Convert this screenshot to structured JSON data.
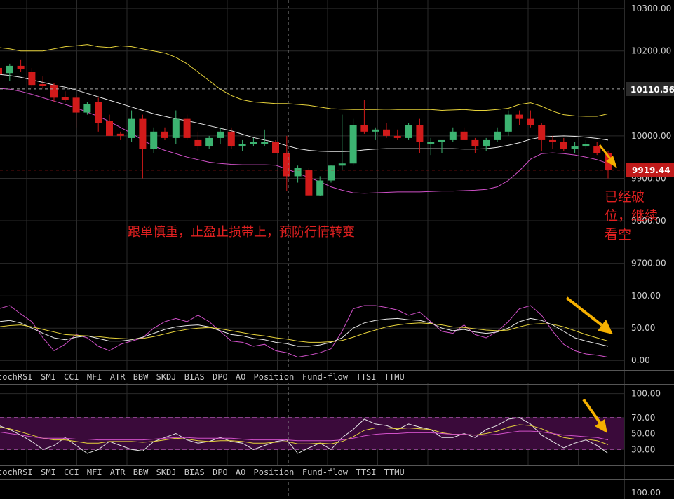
{
  "colors": {
    "background": "#000000",
    "grid": "#2a2a2a",
    "up": "#3cb371",
    "down": "#d11a1a",
    "bb_upper": "#e6d23a",
    "bb_mid": "#e8e8e8",
    "bb_lower": "#d050c8",
    "annotation": "#e02020",
    "arrow": "#f5b000",
    "oscillator_band": "#3a0a3a"
  },
  "chart_data": [
    {
      "type": "candlestick",
      "panel": "price",
      "ylim": [
        9640,
        10320
      ],
      "yticks": [
        "10300.00",
        "10200.00",
        "10000.00",
        "9900.00",
        "9800.00",
        "9700.00"
      ],
      "ytick_values": [
        10300,
        10200,
        10000,
        9900,
        9800,
        9700
      ],
      "price_tag": "10110.56",
      "price_tag_value": 10110.56,
      "last_price": "9919.44",
      "last_price_value": 9919.44,
      "candles": [
        [
          10160,
          10175,
          10140,
          10145
        ],
        [
          10148,
          10170,
          10130,
          10165
        ],
        [
          10165,
          10180,
          10150,
          10158
        ],
        [
          10150,
          10160,
          10110,
          10120
        ],
        [
          10122,
          10140,
          10110,
          10118
        ],
        [
          10120,
          10125,
          10080,
          10090
        ],
        [
          10092,
          10105,
          10080,
          10085
        ],
        [
          10090,
          10095,
          10020,
          10055
        ],
        [
          10055,
          10080,
          10050,
          10075
        ],
        [
          10080,
          10090,
          10010,
          10030
        ],
        [
          10035,
          10050,
          10000,
          10000
        ],
        [
          10005,
          10010,
          9990,
          10000
        ],
        [
          9995,
          10060,
          9985,
          10040
        ],
        [
          10040,
          10050,
          9900,
          9970
        ],
        [
          9970,
          10020,
          9960,
          10010
        ],
        [
          10010,
          10020,
          9990,
          9995
        ],
        [
          9995,
          10060,
          9980,
          10040
        ],
        [
          10040,
          10050,
          9990,
          9995
        ],
        [
          9990,
          10010,
          9965,
          9975
        ],
        [
          9975,
          10000,
          9970,
          9995
        ],
        [
          9995,
          10020,
          9980,
          10010
        ],
        [
          10010,
          10020,
          9970,
          9975
        ],
        [
          9975,
          9990,
          9965,
          9980
        ],
        [
          9980,
          9995,
          9975,
          9985
        ],
        [
          9985,
          10015,
          9975,
          9985
        ],
        [
          9985,
          9990,
          9960,
          9960
        ],
        [
          9960,
          10000,
          9870,
          9905
        ],
        [
          9905,
          9930,
          9890,
          9925
        ],
        [
          9920,
          9925,
          9860,
          9860
        ],
        [
          9860,
          9905,
          9858,
          9895
        ],
        [
          9895,
          9930,
          9890,
          9930
        ],
        [
          9930,
          10050,
          9920,
          9935
        ],
        [
          9935,
          10040,
          9930,
          10025
        ],
        [
          10025,
          10085,
          10005,
          10010
        ],
        [
          10010,
          10020,
          9990,
          10015
        ],
        [
          10015,
          10030,
          9995,
          10000
        ],
        [
          10000,
          10015,
          9990,
          9995
        ],
        [
          9995,
          10030,
          9990,
          10025
        ],
        [
          10025,
          10040,
          9960,
          9985
        ],
        [
          9985,
          9995,
          9955,
          9985
        ],
        [
          9985,
          9990,
          9960,
          9990
        ],
        [
          9990,
          10020,
          9985,
          10010
        ],
        [
          10010,
          10020,
          9990,
          9990
        ],
        [
          9990,
          9995,
          9960,
          9975
        ],
        [
          9975,
          9995,
          9965,
          9990
        ],
        [
          9990,
          10020,
          9985,
          10010
        ],
        [
          10010,
          10060,
          10000,
          10050
        ],
        [
          10050,
          10060,
          10025,
          10040
        ],
        [
          10040,
          10060,
          10020,
          10025
        ],
        [
          10025,
          10030,
          9965,
          9990
        ],
        [
          9990,
          10000,
          9970,
          9985
        ],
        [
          9985,
          9995,
          9965,
          9970
        ],
        [
          9970,
          9985,
          9960,
          9975
        ],
        [
          9975,
          9990,
          9970,
          9980
        ],
        [
          9975,
          9985,
          9955,
          9960
        ],
        [
          9960,
          9965,
          9900,
          9919
        ]
      ],
      "bb_upper": [
        10208,
        10205,
        10200,
        10200,
        10200,
        10205,
        10210,
        10212,
        10215,
        10210,
        10208,
        10212,
        10210,
        10205,
        10200,
        10195,
        10185,
        10170,
        10150,
        10130,
        10110,
        10095,
        10085,
        10080,
        10078,
        10076,
        10076,
        10074,
        10072,
        10068,
        10064,
        10063,
        10062,
        10062,
        10062,
        10063,
        10062,
        10062,
        10062,
        10062,
        10060,
        10061,
        10062,
        10060,
        10060,
        10062,
        10065,
        10074,
        10078,
        10070,
        10058,
        10050,
        10047,
        10046,
        10046,
        10052
      ],
      "bb_mid": [
        10145,
        10142,
        10138,
        10132,
        10126,
        10120,
        10115,
        10108,
        10100,
        10092,
        10084,
        10076,
        10068,
        10060,
        10052,
        10046,
        10040,
        10036,
        10030,
        10024,
        10018,
        10012,
        10004,
        9996,
        9990,
        9985,
        9977,
        9970,
        9966,
        9964,
        9963,
        9963,
        9964,
        9967,
        9969,
        9970,
        9970,
        9970,
        9970,
        9970,
        9970,
        9970,
        9969,
        9969,
        9970,
        9973,
        9978,
        9984,
        9992,
        9997,
        9999,
        10000,
        9999,
        9997,
        9994,
        9990
      ],
      "bb_lower": [
        10112,
        10110,
        10105,
        10098,
        10090,
        10082,
        10074,
        10066,
        10056,
        10046,
        10034,
        10020,
        10006,
        9990,
        9976,
        9966,
        9958,
        9950,
        9944,
        9938,
        9935,
        9933,
        9932,
        9932,
        9932,
        9931,
        9922,
        9912,
        9902,
        9892,
        9880,
        9872,
        9866,
        9865,
        9866,
        9867,
        9868,
        9868,
        9868,
        9869,
        9870,
        9870,
        9871,
        9872,
        9874,
        9880,
        9895,
        9918,
        9945,
        9958,
        9960,
        9958,
        9955,
        9950,
        9944,
        9935
      ]
    },
    {
      "type": "line",
      "panel": "oscillator1",
      "ylim": [
        -15,
        110
      ],
      "yticks": [
        "100.00",
        "50.00",
        "0.00"
      ],
      "ytick_values": [
        100,
        50,
        0
      ],
      "series": [
        {
          "values": [
            80,
            85,
            72,
            60,
            35,
            15,
            25,
            40,
            35,
            22,
            15,
            25,
            30,
            35,
            50,
            60,
            65,
            60,
            70,
            60,
            45,
            30,
            28,
            22,
            25,
            15,
            12,
            5,
            8,
            12,
            18,
            45,
            80,
            85,
            85,
            82,
            78,
            70,
            75,
            60,
            45,
            42,
            55,
            40,
            35,
            45,
            60,
            80,
            85,
            70,
            45,
            25,
            15,
            10,
            8,
            5
          ],
          "color": "#d050c8"
        },
        {
          "values": [
            60,
            62,
            58,
            50,
            42,
            35,
            32,
            36,
            38,
            34,
            30,
            30,
            32,
            36,
            42,
            48,
            52,
            54,
            55,
            52,
            46,
            40,
            38,
            34,
            32,
            28,
            26,
            22,
            22,
            24,
            28,
            35,
            50,
            58,
            62,
            64,
            65,
            63,
            62,
            58,
            50,
            46,
            48,
            44,
            42,
            44,
            50,
            60,
            65,
            62,
            55,
            45,
            35,
            30,
            26,
            22
          ],
          "color": "#e8e8e8"
        },
        {
          "values": [
            52,
            54,
            55,
            52,
            48,
            44,
            40,
            39,
            38,
            37,
            35,
            34,
            33,
            34,
            37,
            41,
            45,
            48,
            50,
            51,
            49,
            46,
            43,
            40,
            38,
            35,
            33,
            30,
            28,
            28,
            29,
            31,
            36,
            42,
            47,
            52,
            55,
            57,
            58,
            57,
            55,
            52,
            51,
            49,
            47,
            46,
            47,
            52,
            56,
            57,
            56,
            52,
            46,
            40,
            35,
            30
          ],
          "color": "#e6d23a"
        }
      ]
    },
    {
      "type": "line",
      "panel": "oscillator2",
      "ylim": [
        10,
        112
      ],
      "yticks": [
        "100.00",
        "70.00",
        "50.00",
        "30.00"
      ],
      "ytick_values": [
        100,
        70,
        50,
        30
      ],
      "band": [
        30,
        70
      ],
      "series": [
        {
          "values": [
            60,
            55,
            48,
            40,
            30,
            35,
            45,
            35,
            25,
            30,
            40,
            35,
            30,
            28,
            40,
            45,
            50,
            42,
            38,
            40,
            45,
            40,
            38,
            30,
            35,
            40,
            42,
            25,
            32,
            38,
            30,
            45,
            55,
            68,
            62,
            60,
            55,
            62,
            58,
            55,
            45,
            45,
            50,
            45,
            55,
            60,
            68,
            70,
            62,
            48,
            40,
            32,
            38,
            42,
            35,
            25
          ],
          "color": "#e8e8e8"
        },
        {
          "values": [
            58,
            56,
            52,
            48,
            44,
            42,
            42,
            40,
            38,
            38,
            40,
            40,
            40,
            39,
            40,
            42,
            44,
            43,
            41,
            40,
            41,
            41,
            40,
            38,
            38,
            39,
            40,
            37,
            37,
            38,
            37,
            40,
            46,
            54,
            57,
            57,
            56,
            57,
            56,
            55,
            51,
            49,
            49,
            48,
            50,
            53,
            58,
            61,
            60,
            56,
            50,
            45,
            43,
            43,
            41,
            36
          ],
          "color": "#e6d23a"
        },
        {
          "values": [
            52,
            50,
            48,
            46,
            44,
            44,
            44,
            43,
            43,
            42,
            42,
            42,
            42,
            42,
            43,
            44,
            45,
            45,
            44,
            44,
            44,
            44,
            43,
            42,
            42,
            42,
            42,
            41,
            41,
            41,
            41,
            42,
            44,
            47,
            49,
            50,
            50,
            51,
            51,
            51,
            50,
            49,
            49,
            48,
            48,
            49,
            51,
            53,
            53,
            52,
            50,
            48,
            47,
            46,
            45,
            42
          ],
          "color": "#d050c8"
        }
      ],
      "next_panel_ytick": "100.00"
    }
  ],
  "annotations": {
    "main_note": "跟单慎重，止盈止损带上，预防行情转变",
    "side_note_lines": [
      "已经破",
      "位，继续",
      "看空"
    ]
  },
  "indicator_tabs": [
    "tochRSI",
    "SMI",
    "CCI",
    "MFI",
    "ATR",
    "BBW",
    "SKDJ",
    "BIAS",
    "DPO",
    "AO",
    "Position",
    "Fund-flow",
    "TTSI",
    "TTMU"
  ]
}
